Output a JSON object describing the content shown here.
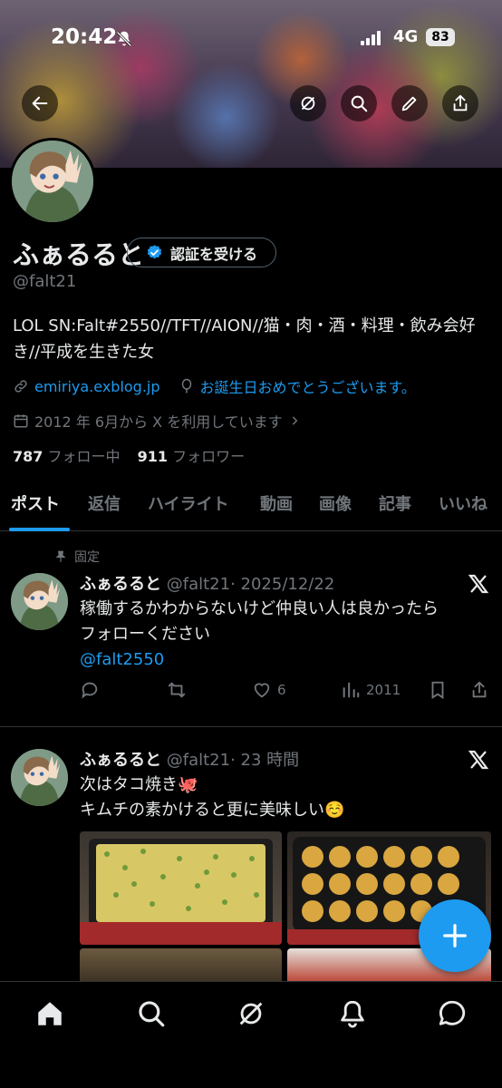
{
  "status_bar": {
    "time": "20:42",
    "network": "4G",
    "battery": "83"
  },
  "header": {
    "back_icon": "back-arrow-icon",
    "grok_icon": "grok-icon",
    "search_icon": "search-icon",
    "edit_icon": "pencil-icon",
    "share_icon": "share-icon"
  },
  "profile": {
    "name": "ふぁるると",
    "verify_label": "認証を受ける",
    "handle": "@falt21",
    "bio": "LOL SN:Falt#2550//TFT//AION//猫・肉・酒・料理・飲み会好き//平成を生きた女",
    "website": "emiriya.exblog.jp",
    "birthday": "お誕生日おめでとうございます。",
    "joined": "2012 年 6月から X を利用しています",
    "following_count": "787",
    "following_label": "フォロー中",
    "followers_count": "911",
    "followers_label": "フォロワー"
  },
  "tabs": [
    "ポスト",
    "返信",
    "ハイライト",
    "動画",
    "画像",
    "記事",
    "いいね"
  ],
  "posts": [
    {
      "pinned_label": "固定",
      "name": "ふぁるると",
      "handle": "@falt21",
      "time": "· 2025/12/22",
      "text_line1": "稼働するかわからないけど仲良い人は良かったら",
      "text_line2": "フォローください",
      "mention": "@falt2550",
      "likes": "6",
      "views": "2011"
    },
    {
      "name": "ふぁるると",
      "handle": "@falt21",
      "time": "· 23 時間",
      "text_line1": "次はタコ焼き🐙",
      "text_line2": "キムチの素かけると更に美味しい☺️"
    }
  ],
  "colors": {
    "accent": "#1d9bf0",
    "text": "#e7e9ea",
    "muted": "#71767b",
    "border": "#2f3336"
  },
  "bottom_nav": [
    "home-icon",
    "search-icon",
    "grok-icon",
    "notifications-icon",
    "messages-icon"
  ]
}
